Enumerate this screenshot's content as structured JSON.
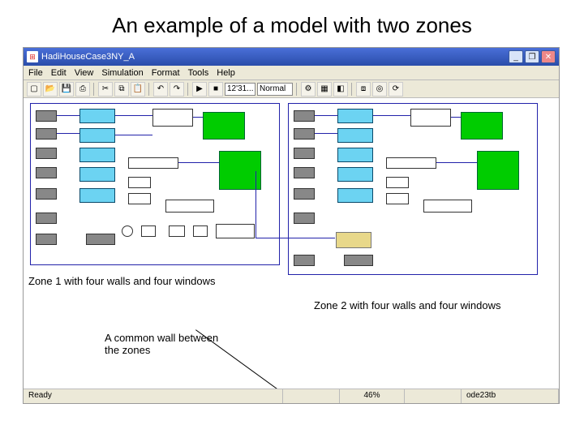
{
  "slide": {
    "title": "An example of a model with two zones"
  },
  "window": {
    "title": "HadiHouseCase3NY_A"
  },
  "menu": {
    "file": "File",
    "edit": "Edit",
    "view": "View",
    "simulation": "Simulation",
    "format": "Format",
    "tools": "Tools",
    "help": "Help"
  },
  "toolbar": {
    "time": "12'31...",
    "mode": "Normal"
  },
  "status": {
    "ready": "Ready",
    "pct": "46%",
    "solver": "ode23tb"
  },
  "annotations": {
    "zone1": "Zone 1 with four walls and four windows",
    "zone2": "Zone 2 with four walls and four windows",
    "common": "A common wall between the zones"
  },
  "winbtns": {
    "min": "_",
    "max": "❐",
    "close": "✕"
  }
}
